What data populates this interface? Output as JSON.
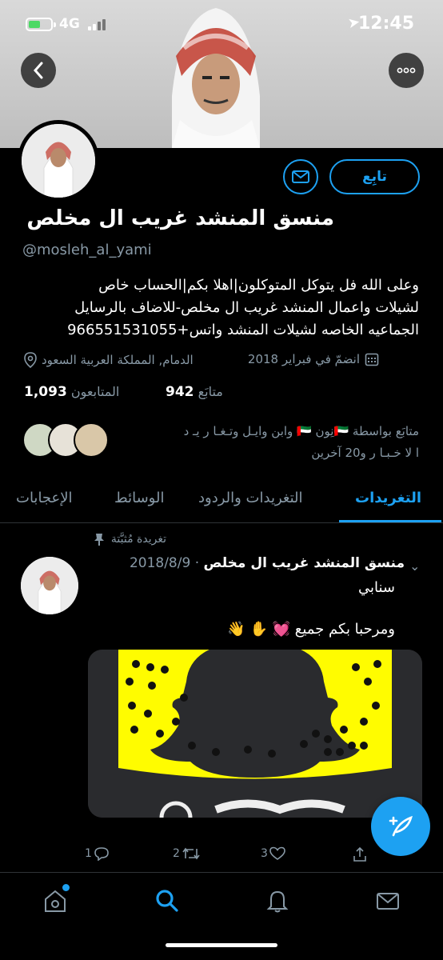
{
  "status_bar": {
    "network": "4G",
    "time": "12:45"
  },
  "header": {
    "back_icon": "chevron-left-icon",
    "more_icon": "ellipsis-icon"
  },
  "profile": {
    "follow_label": "تابِع",
    "name": "منسق المنشد غريب ال مخلص",
    "handle": "@mosleh_al_yami",
    "bio_lines": [
      "وعلى الله فل يتوكل المتوكلون|اهلا بكم|الحساب خاص",
      "لشيلات واعمال المنشد غريب ال مخلص-للاضاف بالرسايل",
      "الجماعيه الخاصه لشيلات المنشد واتس+966551531055"
    ],
    "joined": "انضمّ في فبراير 2018",
    "location": "الدمام, المملكة العربية السعود",
    "following_count": "942",
    "following_label": "متابَع",
    "followers_count": "1,093",
    "followers_label": "المتابعون",
    "mutuals_line1": "متابَع بواسطة 🇦🇪نِون 🇦🇪 وابن وايـل وتـغـا ر يـ د",
    "mutuals_line2": "ا لا خـبـا ر و20 آخرين"
  },
  "tabs": [
    {
      "label": "التغريدات",
      "active": true
    },
    {
      "label": "التغريدات والردود",
      "active": false
    },
    {
      "label": "الوسائط",
      "active": false
    },
    {
      "label": "الإعجابات",
      "active": false
    }
  ],
  "tweet": {
    "pinned_label": "تغريدة مُثبَّتة",
    "author": "منسق المنشد غريب ال مخلص",
    "date": "· 2018/8/9",
    "text_line1": "سنابي",
    "text_line2": "ومرحبا بكم جميع 💓 ✋ 👋",
    "reply_count": "1",
    "retweet_count": "2",
    "like_count": "3"
  },
  "colors": {
    "accent": "#1da1f2",
    "muted": "#8899a6",
    "snap_yellow": "#fffc00"
  },
  "nav": [
    "home-icon",
    "search-icon",
    "notifications-icon",
    "messages-icon"
  ]
}
